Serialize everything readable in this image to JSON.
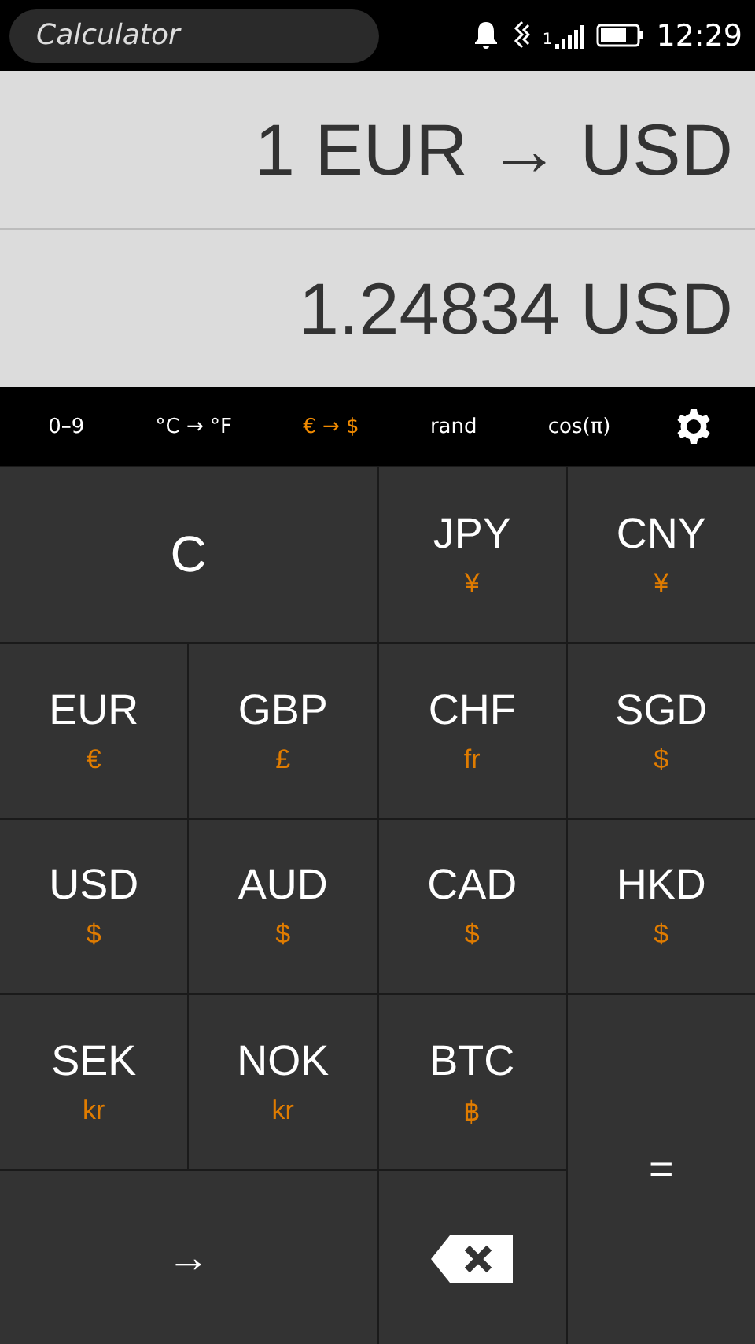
{
  "status_bar": {
    "title": "Calculator",
    "sim": "1",
    "time": "12:29"
  },
  "display": {
    "expression": "1 EUR → USD",
    "result": "1.24834 USD"
  },
  "modes": [
    {
      "label": "0–9",
      "selected": false
    },
    {
      "label": "°C → °F",
      "selected": false
    },
    {
      "label": "€ → $",
      "selected": true
    },
    {
      "label": "rand",
      "selected": false
    },
    {
      "label": "cos(π)",
      "selected": false
    }
  ],
  "keys": [
    {
      "kind": "clear",
      "label": "C"
    },
    {
      "kind": "currency",
      "label": "JPY",
      "symbol": "¥"
    },
    {
      "kind": "currency",
      "label": "CNY",
      "symbol": "¥"
    },
    {
      "kind": "currency",
      "label": "EUR",
      "symbol": "€"
    },
    {
      "kind": "currency",
      "label": "GBP",
      "symbol": "£"
    },
    {
      "kind": "currency",
      "label": "CHF",
      "symbol": "fr"
    },
    {
      "kind": "currency",
      "label": "SGD",
      "symbol": "$"
    },
    {
      "kind": "currency",
      "label": "USD",
      "symbol": "$"
    },
    {
      "kind": "currency",
      "label": "AUD",
      "symbol": "$"
    },
    {
      "kind": "currency",
      "label": "CAD",
      "symbol": "$"
    },
    {
      "kind": "currency",
      "label": "HKD",
      "symbol": "$"
    },
    {
      "kind": "currency",
      "label": "SEK",
      "symbol": "kr"
    },
    {
      "kind": "currency",
      "label": "NOK",
      "symbol": "kr"
    },
    {
      "kind": "currency",
      "label": "BTC",
      "symbol": "฿"
    },
    {
      "kind": "equals",
      "label": "="
    },
    {
      "kind": "arrow",
      "label": "→"
    },
    {
      "kind": "backspace"
    }
  ]
}
